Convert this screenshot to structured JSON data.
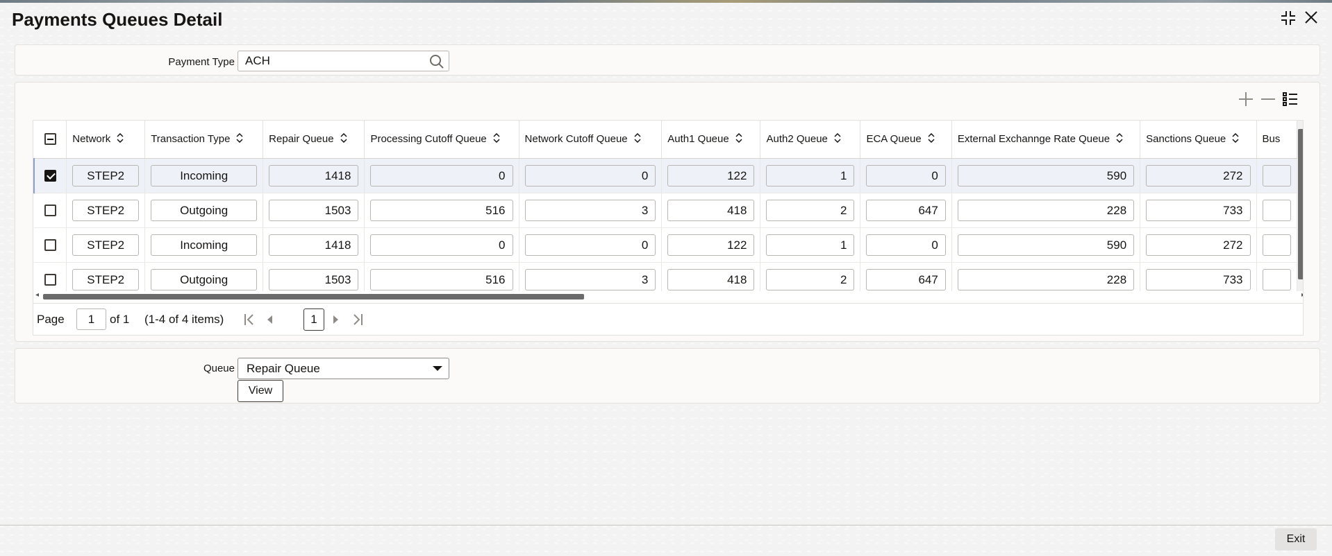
{
  "title": "Payments Queues Detail",
  "window": {
    "collapse_icon": "collapse-icon",
    "close_icon": "close-icon"
  },
  "filter": {
    "payment_type_label": "Payment Type",
    "payment_type_value": "ACH",
    "search_icon": "search-icon"
  },
  "grid": {
    "toolbar": {
      "add_icon": "plus-icon",
      "remove_icon": "minus-icon",
      "columns_icon": "list-icon"
    },
    "columns": [
      "Network",
      "Transaction Type",
      "Repair Queue",
      "Processing Cutoff Queue",
      "Network Cutoff Queue",
      "Auth1 Queue",
      "Auth2 Queue",
      "ECA Queue",
      "External Exchannge Rate Queue",
      "Sanctions Queue",
      "Bus"
    ],
    "rows": [
      {
        "selected": true,
        "network": "STEP2",
        "transaction_type": "Incoming",
        "repair": "1418",
        "processing_cutoff": "0",
        "network_cutoff": "0",
        "auth1": "122",
        "auth2": "1",
        "eca": "0",
        "ext_exchange": "590",
        "sanctions": "272",
        "bus": ""
      },
      {
        "selected": false,
        "network": "STEP2",
        "transaction_type": "Outgoing",
        "repair": "1503",
        "processing_cutoff": "516",
        "network_cutoff": "3",
        "auth1": "418",
        "auth2": "2",
        "eca": "647",
        "ext_exchange": "228",
        "sanctions": "733",
        "bus": ""
      },
      {
        "selected": false,
        "network": "STEP2",
        "transaction_type": "Incoming",
        "repair": "1418",
        "processing_cutoff": "0",
        "network_cutoff": "0",
        "auth1": "122",
        "auth2": "1",
        "eca": "0",
        "ext_exchange": "590",
        "sanctions": "272",
        "bus": ""
      },
      {
        "selected": false,
        "network": "STEP2",
        "transaction_type": "Outgoing",
        "repair": "1503",
        "processing_cutoff": "516",
        "network_cutoff": "3",
        "auth1": "418",
        "auth2": "2",
        "eca": "647",
        "ext_exchange": "228",
        "sanctions": "733",
        "bus": ""
      }
    ]
  },
  "pagination": {
    "page_label": "Page",
    "page_value": "1",
    "of_label": "of 1",
    "items_label": "(1-4 of 4 items)",
    "current_page": "1"
  },
  "queue": {
    "label": "Queue",
    "selected": "Repair Queue",
    "view_label": "View"
  },
  "footer": {
    "exit_label": "Exit"
  }
}
